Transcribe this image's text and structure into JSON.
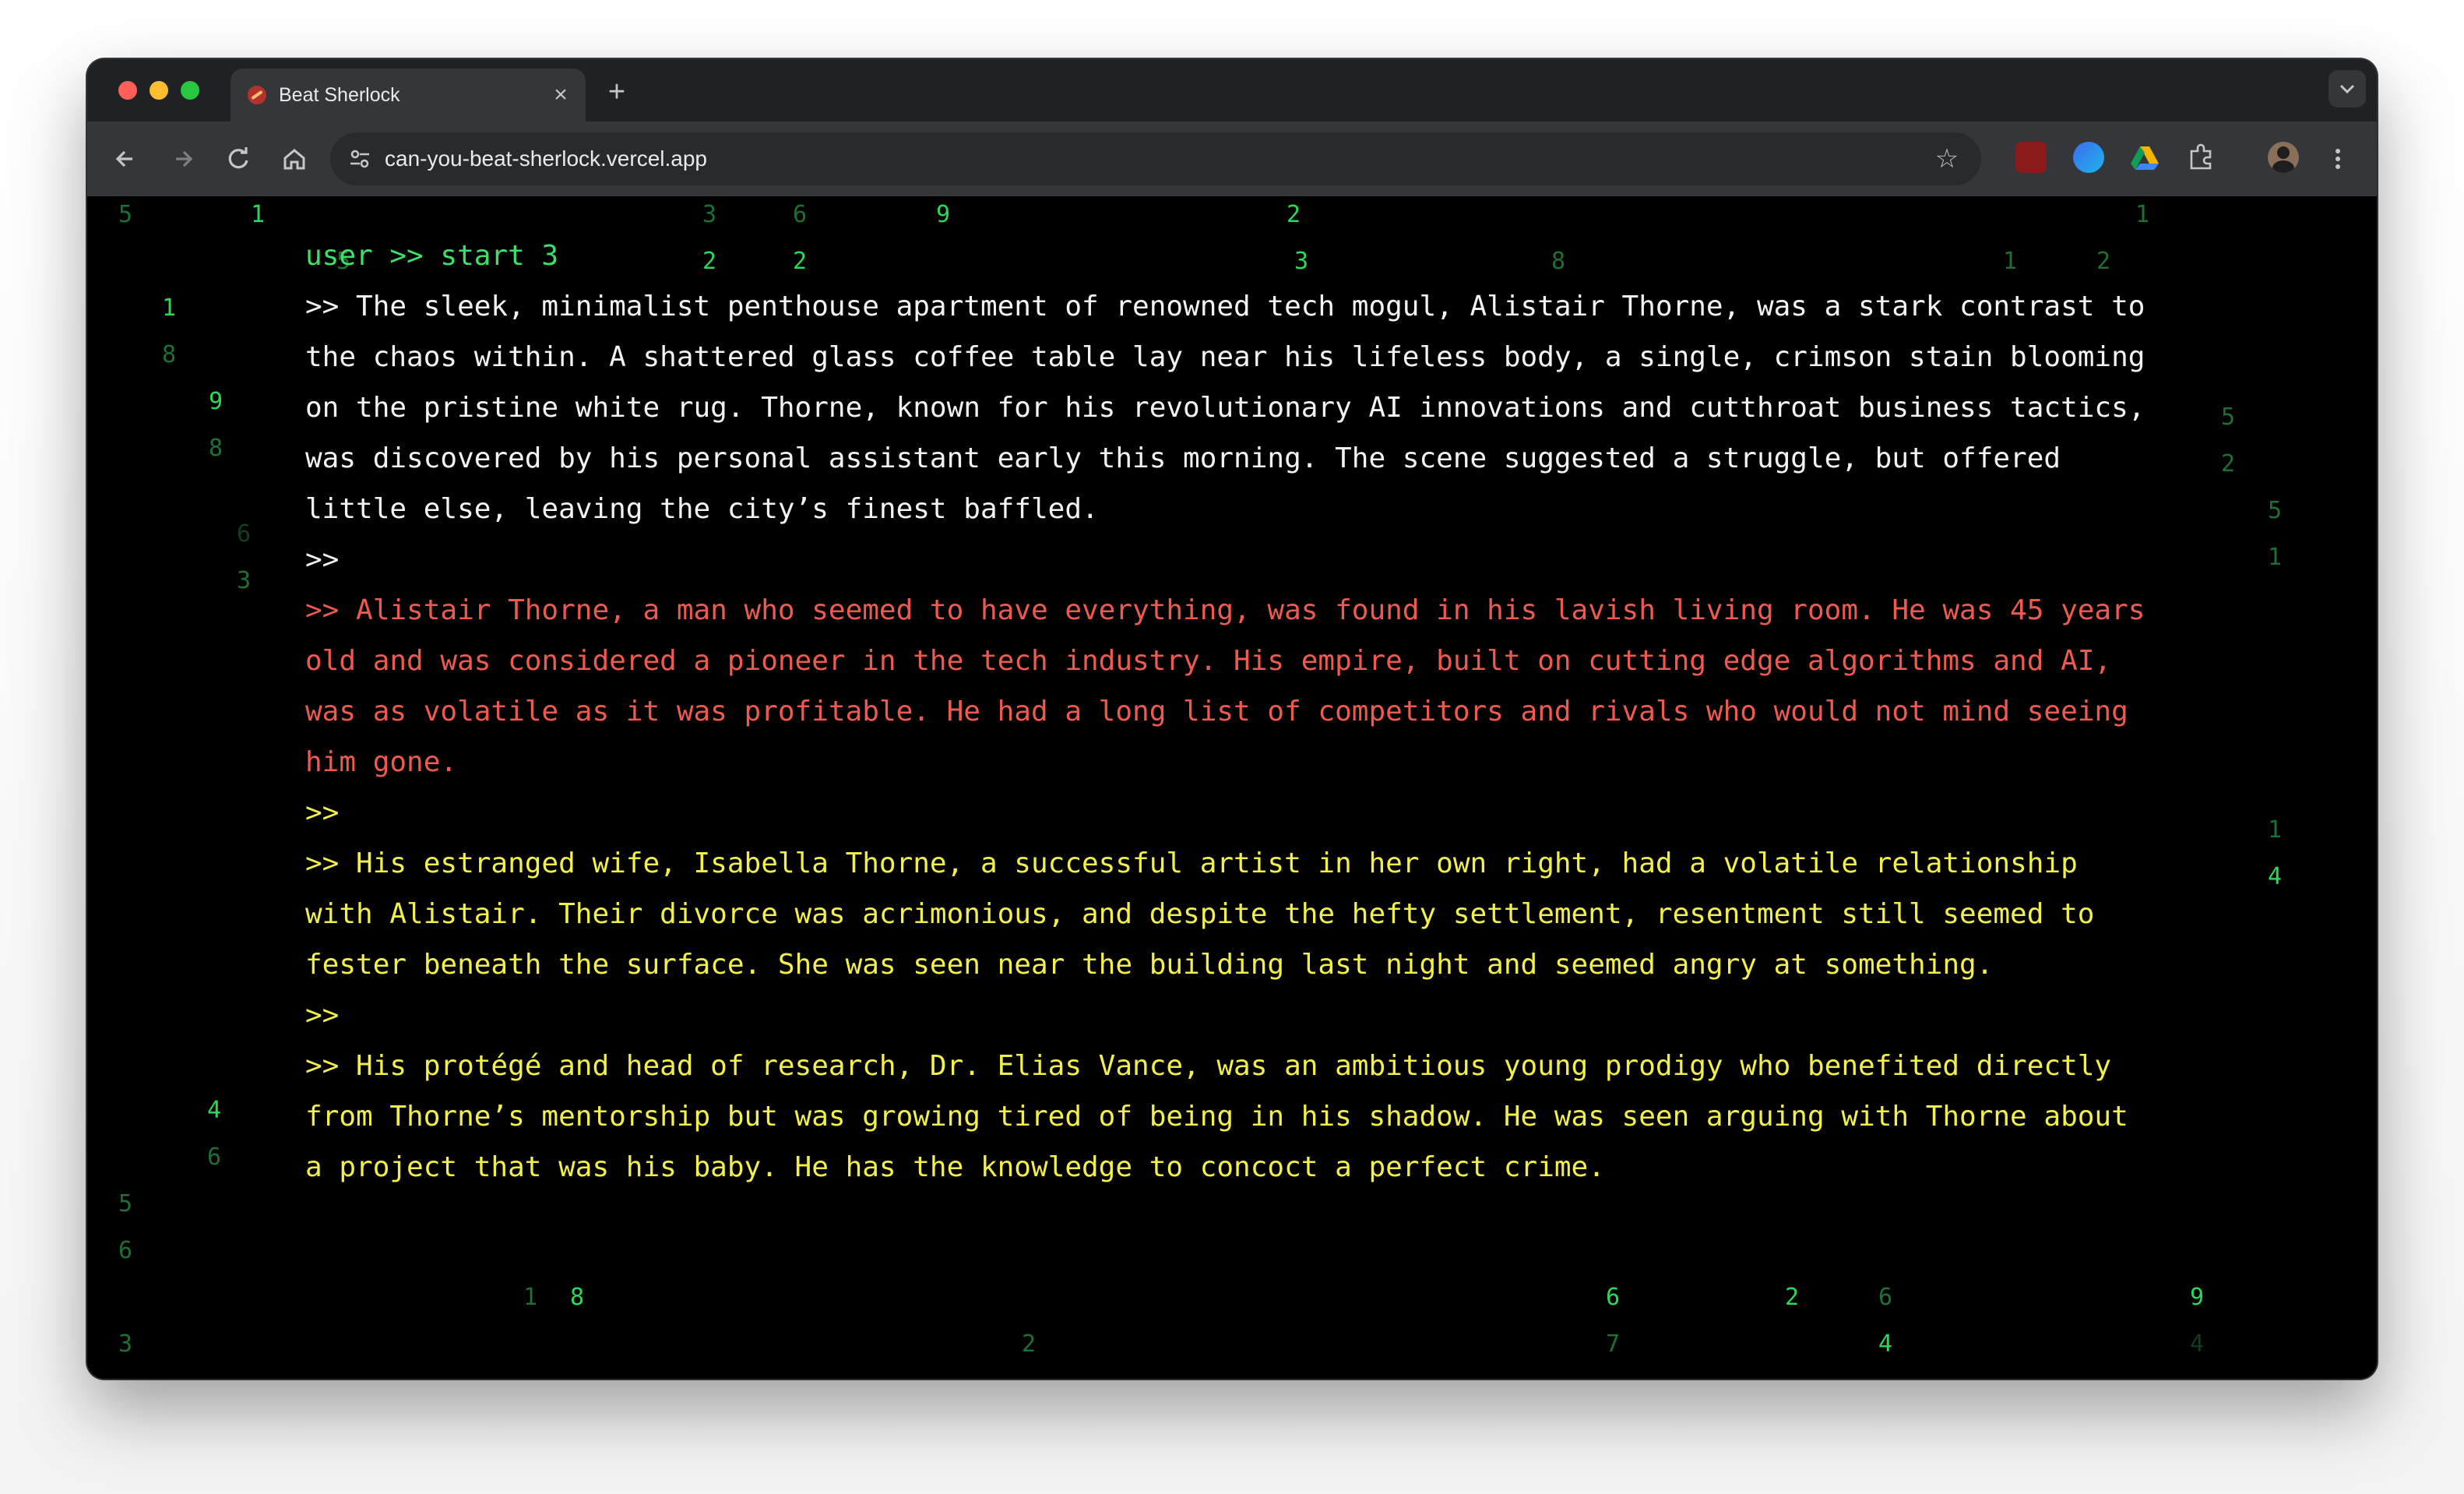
{
  "browser": {
    "tab": {
      "title": "Beat Sherlock"
    },
    "address_bar": {
      "url": "can-you-beat-sherlock.vercel.app"
    },
    "icons": [
      "back-icon",
      "forward-icon",
      "reload-icon",
      "home-icon",
      "site-info-icon",
      "star-icon",
      "ublock-extension-icon",
      "copilot-extension-icon",
      "drive-extension-icon",
      "extensions-puzzle-icon",
      "profile-avatar",
      "kebab-menu-icon"
    ]
  },
  "terminal": {
    "command": "user >> start 3",
    "intro": ">> The sleek, minimalist penthouse apartment of renowned tech mogul, Alistair Thorne, was a stark contrast to the chaos within. A shattered glass coffee table lay near his lifeless body, a single, crimson stain blooming on the pristine white rug. Thorne, known for his revolutionary AI innovations and cutthroat business tactics, was discovered by his personal assistant early this morning. The scene suggested a struggle, but offered little else, leaving the city’s finest baffled.",
    "separator": ">>",
    "victim": ">> Alistair Thorne, a man who seemed to have everything, was found in his lavish living room. He was 45 years old and was considered a pioneer in the tech industry. His empire, built on cutting edge algorithms and AI, was as volatile as it was profitable. He had a long list of competitors and rivals who would not mind seeing him gone.",
    "suspect_1": ">> His estranged wife, Isabella Thorne, a successful artist in her own right, had a volatile relationship with Alistair. Their divorce was acrimonious, and despite the hefty settlement, resentment still seemed to fester beneath the surface. She was seen near the building last night and seemed angry at something.",
    "suspect_2": ">> His protégé and head of research, Dr. Elias Vance, was an ambitious young prodigy who benefited directly from Thorne’s mentorship but was growing tired of being in his shadow. He was seen arguing with Thorne about a project that was his baby. He has the knowledge to concoct a perfect crime."
  },
  "colors": {
    "command": "#3ee06a",
    "intro": "#f2f2f2",
    "victim": "#ee5a50",
    "suspects": "#f2ee4a",
    "rain": "#2bd957"
  },
  "digit_rain": {
    "visible_digits": [
      "5",
      "1",
      "3",
      "6",
      "9",
      "2",
      "1",
      "5",
      "2",
      "2",
      "3",
      "8",
      "1",
      "2",
      "1",
      "8",
      "9",
      "8",
      "6",
      "3",
      "5",
      "2",
      "5",
      "1",
      "1",
      "4",
      "4",
      "6",
      "5",
      "6",
      "1",
      "8",
      "3",
      "2",
      "6",
      "2",
      "6",
      "4",
      "7",
      "9",
      "4"
    ]
  }
}
